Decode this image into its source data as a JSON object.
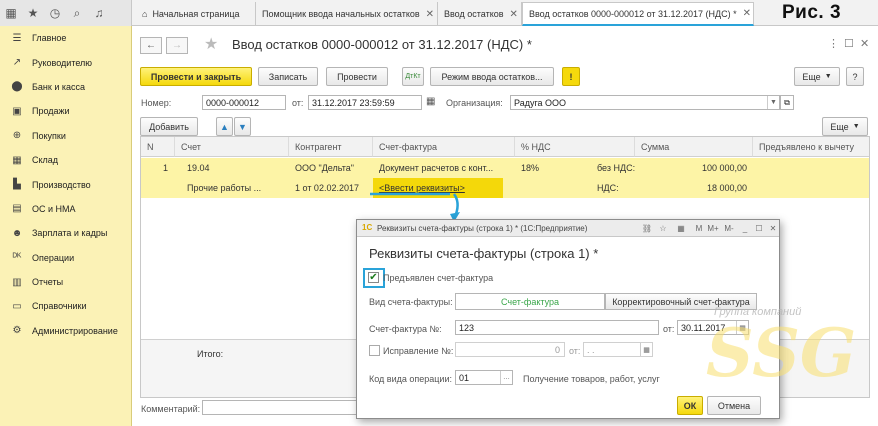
{
  "tabs": [
    {
      "label": "Начальная страница"
    },
    {
      "label": "Помощник ввода начальных остатков"
    },
    {
      "label": "Ввод остатков"
    },
    {
      "label": "Ввод остатков 0000-000012 от 31.12.2017 (НДС) *"
    }
  ],
  "figure_label": "Рис. 3",
  "sidebar": {
    "items": [
      {
        "label": "Главное",
        "icon": "menu-icon",
        "glyph": "☰"
      },
      {
        "label": "Руководителю",
        "icon": "trend-icon",
        "glyph": "↗"
      },
      {
        "label": "Банк и касса",
        "icon": "bank-icon",
        "glyph": "⬤"
      },
      {
        "label": "Продажи",
        "icon": "sales-icon",
        "glyph": "▣"
      },
      {
        "label": "Покупки",
        "icon": "cart-icon",
        "glyph": "⊕"
      },
      {
        "label": "Склад",
        "icon": "warehouse-icon",
        "glyph": "▦"
      },
      {
        "label": "Производство",
        "icon": "factory-icon",
        "glyph": "▙"
      },
      {
        "label": "ОС и НМА",
        "icon": "assets-icon",
        "glyph": "▤"
      },
      {
        "label": "Зарплата и кадры",
        "icon": "people-icon",
        "glyph": "☻"
      },
      {
        "label": "Операции",
        "icon": "operations-icon",
        "glyph": "ᴰᴷ"
      },
      {
        "label": "Отчеты",
        "icon": "reports-icon",
        "glyph": "▥"
      },
      {
        "label": "Справочники",
        "icon": "book-icon",
        "glyph": "▭"
      },
      {
        "label": "Администрирование",
        "icon": "gear-icon",
        "glyph": "⚙"
      }
    ]
  },
  "document": {
    "title": "Ввод остатков 0000-000012 от 31.12.2017 (НДС) *",
    "toolbar": {
      "post_close": "Провести и закрыть",
      "save": "Записать",
      "post": "Провести",
      "mode": "Режим ввода остатков...",
      "more": "Еще",
      "help": "?"
    },
    "number_label": "Номер:",
    "number": "0000-000012",
    "date_label": "от:",
    "date": "31.12.2017 23:59:59",
    "org_label": "Организация:",
    "org": "Радуга ООО",
    "add": "Добавить",
    "more2": "Еще",
    "columns": [
      "N",
      "Счет",
      "Контрагент",
      "Счет-фактура",
      "% НДС",
      "Сумма",
      "Предъявлено к вычету"
    ],
    "row": {
      "n": "1",
      "account": "19.04",
      "account2": "Прочие работы ...",
      "counterparty": "ООО \"Дельта\"",
      "counterparty2": "1 от 02.02.2017",
      "invoice": "Документ расчетов с конт...",
      "invoice2": "<Ввести реквизиты>",
      "vat_rate": "18%",
      "no_vat_label": "без НДС:",
      "no_vat_sum": "100 000,00",
      "vat_label": "НДС:",
      "vat_sum": "18 000,00"
    },
    "total_label": "Итого:",
    "comment_label": "Комментарий:"
  },
  "dialog": {
    "window_title": "Реквизиты счета-фактуры (строка 1) * (1С:Предприятие)",
    "title": "Реквизиты счета-фактуры (строка 1) *",
    "presented_label": "Предъявлен счет-фактура",
    "presented_checked": true,
    "kind_label": "Вид счета-фактуры:",
    "kind_options": [
      "Счет-фактура",
      "Корректировочный счет-фактура"
    ],
    "kind_selected": "Счет-фактура",
    "invoice_no_label": "Счет-фактура №:",
    "invoice_no": "123",
    "invoice_date_label": "от:",
    "invoice_date": "30.11.2017",
    "correction_label": "Исправление №:",
    "correction_no": "0",
    "correction_date_label": "от:",
    "correction_date": ". .",
    "op_code_label": "Код вида операции:",
    "op_code": "01",
    "op_code_desc": "Получение товаров, работ, услуг",
    "ok": "ОК",
    "cancel": "Отмена"
  },
  "watermark": {
    "text": "Группа компаний",
    "logo": "SSG"
  },
  "colors": {
    "accent": "#2aa3d9",
    "sidebar": "#fbf2b6",
    "primary_button": "#f5d90c",
    "selection": "#fdf4a6"
  }
}
